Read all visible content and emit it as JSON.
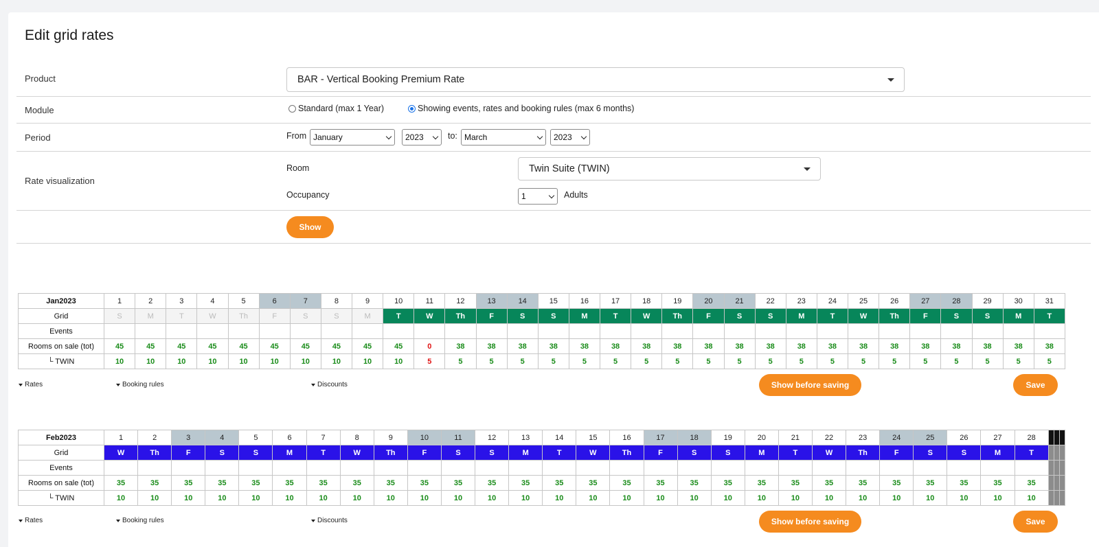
{
  "page": {
    "title": "Edit grid rates"
  },
  "form": {
    "product": {
      "label": "Product",
      "value": "BAR - Vertical Booking Premium Rate"
    },
    "module": {
      "label": "Module",
      "options": [
        {
          "label": "Standard (max 1 Year)",
          "checked": false
        },
        {
          "label": "Showing events, rates and booking rules (max 6 months)",
          "checked": true
        }
      ]
    },
    "period": {
      "label": "Period",
      "from_label": "From",
      "to_label": "to:",
      "from_month": "January",
      "from_year": "2023",
      "to_month": "March",
      "to_year": "2023"
    },
    "rate_visualization": {
      "label": "Rate visualization",
      "room_label": "Room",
      "room_value": "Twin Suite (TWIN)",
      "occupancy_label": "Occupancy",
      "occupancy_value": "1",
      "adults_label": "Adults"
    },
    "show_button": "Show"
  },
  "labels": {
    "grid": "Grid",
    "events": "Events",
    "rooms_on_sale": "Rooms on sale (tot)",
    "twin": "└ TWIN",
    "rates": "Rates",
    "booking_rules": "Booking rules",
    "discounts": "Discounts",
    "show_before_saving": "Show before saving",
    "save": "Save"
  },
  "months": [
    {
      "name": "Jan2023",
      "days": [
        "1",
        "2",
        "3",
        "4",
        "5",
        "6",
        "7",
        "8",
        "9",
        "10",
        "11",
        "12",
        "13",
        "14",
        "15",
        "16",
        "17",
        "18",
        "19",
        "20",
        "21",
        "22",
        "23",
        "24",
        "25",
        "26",
        "27",
        "28",
        "29",
        "30",
        "31"
      ],
      "weekdays": [
        "S",
        "M",
        "T",
        "W",
        "Th",
        "F",
        "S",
        "S",
        "M",
        "T",
        "W",
        "Th",
        "F",
        "S",
        "S",
        "M",
        "T",
        "W",
        "Th",
        "F",
        "S",
        "S",
        "M",
        "T",
        "W",
        "Th",
        "F",
        "S",
        "S",
        "M",
        "T"
      ],
      "rooms_total": [
        "45",
        "45",
        "45",
        "45",
        "45",
        "45",
        "45",
        "45",
        "45",
        "45",
        "0",
        "38",
        "38",
        "38",
        "38",
        "38",
        "38",
        "38",
        "38",
        "38",
        "38",
        "38",
        "38",
        "38",
        "38",
        "38",
        "38",
        "38",
        "38",
        "38",
        "38"
      ],
      "twin": [
        "10",
        "10",
        "10",
        "10",
        "10",
        "10",
        "10",
        "10",
        "10",
        "10",
        "5",
        "5",
        "5",
        "5",
        "5",
        "5",
        "5",
        "5",
        "5",
        "5",
        "5",
        "5",
        "5",
        "5",
        "5",
        "5",
        "5",
        "5",
        "5",
        "5",
        "5"
      ],
      "weekend_days": [
        6,
        7,
        13,
        14,
        20,
        21,
        27,
        28
      ],
      "past_days": 9,
      "grid_color": "#07865a",
      "red_days": [
        11
      ]
    },
    {
      "name": "Feb2023",
      "days": [
        "1",
        "2",
        "3",
        "4",
        "5",
        "6",
        "7",
        "8",
        "9",
        "10",
        "11",
        "12",
        "13",
        "14",
        "15",
        "16",
        "17",
        "18",
        "19",
        "20",
        "21",
        "22",
        "23",
        "24",
        "25",
        "26",
        "27",
        "28"
      ],
      "weekdays": [
        "W",
        "Th",
        "F",
        "S",
        "S",
        "M",
        "T",
        "W",
        "Th",
        "F",
        "S",
        "S",
        "M",
        "T",
        "W",
        "Th",
        "F",
        "S",
        "S",
        "M",
        "T",
        "W",
        "Th",
        "F",
        "S",
        "S",
        "M",
        "T"
      ],
      "rooms_total": [
        "35",
        "35",
        "35",
        "35",
        "35",
        "35",
        "35",
        "35",
        "35",
        "35",
        "35",
        "35",
        "35",
        "35",
        "35",
        "35",
        "35",
        "35",
        "35",
        "35",
        "35",
        "35",
        "35",
        "35",
        "35",
        "35",
        "35",
        "35"
      ],
      "twin": [
        "10",
        "10",
        "10",
        "10",
        "10",
        "10",
        "10",
        "10",
        "10",
        "10",
        "10",
        "10",
        "10",
        "10",
        "10",
        "10",
        "10",
        "10",
        "10",
        "10",
        "10",
        "10",
        "10",
        "10",
        "10",
        "10",
        "10",
        "10"
      ],
      "weekend_days": [
        3,
        4,
        10,
        11,
        17,
        18,
        24,
        25
      ],
      "past_days": 0,
      "grid_color": "#2a12e8",
      "red_days": []
    }
  ]
}
